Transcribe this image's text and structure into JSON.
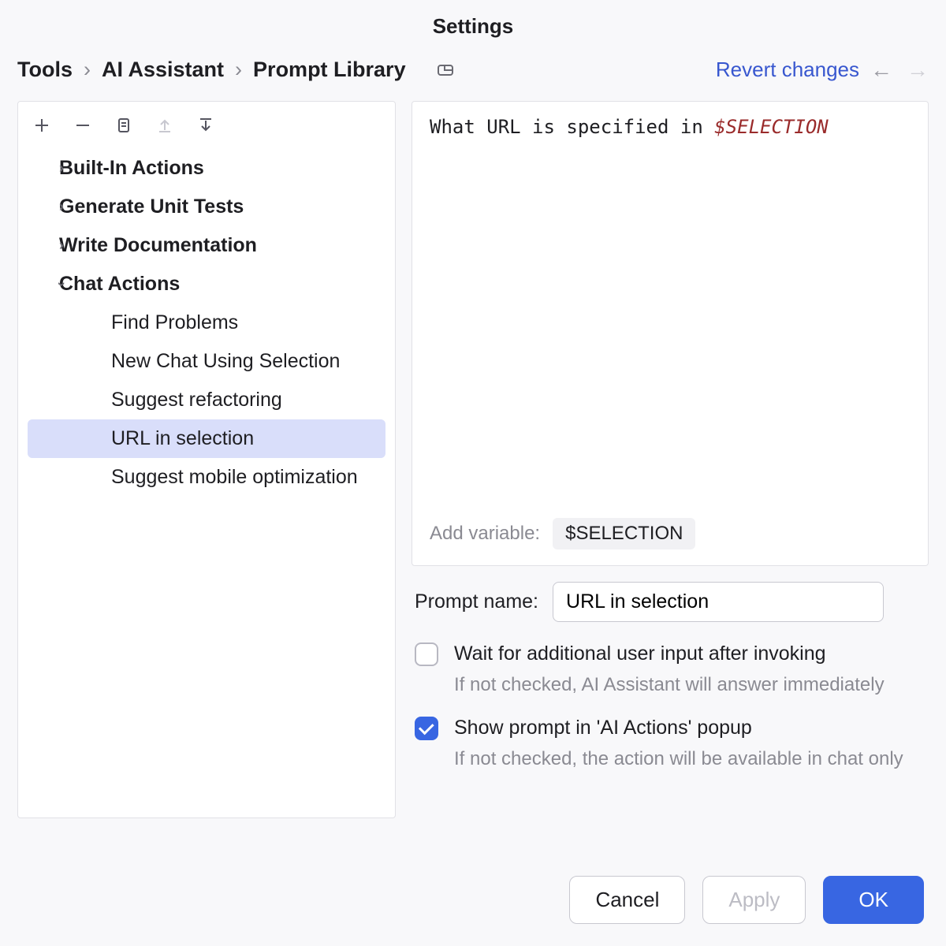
{
  "title": "Settings",
  "breadcrumb": [
    "Tools",
    "AI Assistant",
    "Prompt Library"
  ],
  "revert_label": "Revert changes",
  "tree": {
    "builtin": "Built-In Actions",
    "gentests": "Generate Unit Tests",
    "writedoc": "Write Documentation",
    "chatactions": "Chat Actions",
    "children": [
      "Find Problems",
      "New Chat Using Selection",
      "Suggest refactoring",
      "URL in selection",
      "Suggest mobile optimization"
    ]
  },
  "editor": {
    "text_before_var": "What URL is specified in ",
    "var": "$SELECTION"
  },
  "addvar": {
    "label": "Add variable:",
    "chip": "$SELECTION"
  },
  "name": {
    "label": "Prompt name:",
    "value": "URL in selection"
  },
  "opt_wait": {
    "label": "Wait for additional user input after invoking",
    "sub": "If not checked, AI Assistant will answer immediately",
    "checked": false
  },
  "opt_show": {
    "label": "Show prompt in 'AI Actions' popup",
    "sub": "If not checked, the action will be available in chat only",
    "checked": true
  },
  "buttons": {
    "cancel": "Cancel",
    "apply": "Apply",
    "ok": "OK"
  }
}
